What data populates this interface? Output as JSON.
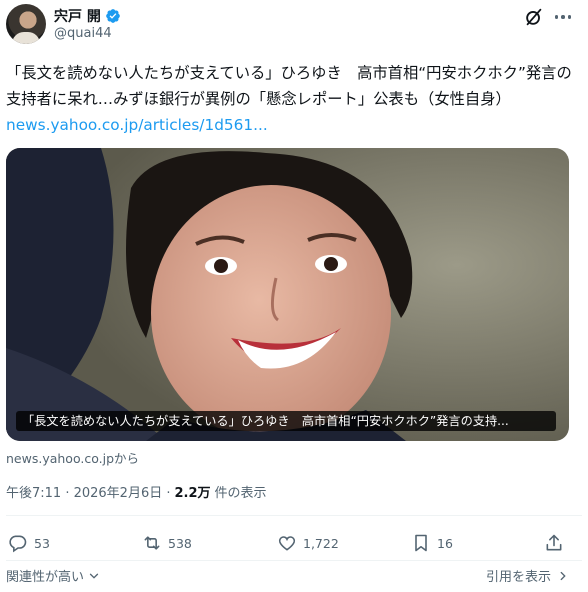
{
  "author": {
    "display_name": "宍戸 開",
    "handle": "@quai44"
  },
  "tweet": {
    "text": "「長文を読めない人たちが支えている」ひろゆき　高市首相“円安ホクホク”発言の支持者に呆れ…みずほ銀行が異例の「懸念レポート」公表も（女性自身）",
    "link": "news.yahoo.co.jp/articles/1d561..."
  },
  "card": {
    "caption": "「長文を読めない人たちが支えている」ひろゆき　高市首相“円安ホクホク”発言の支持...",
    "source": "news.yahoo.co.jpから"
  },
  "meta": {
    "timestamp": "午後7:11 · 2026年2月6日 ·",
    "views_count": "2.2万",
    "views_label": "件の表示"
  },
  "actions": {
    "replies": "53",
    "retweets": "538",
    "likes": "1,722",
    "bookmarks": "16"
  },
  "footer": {
    "sort_label": "関連性が高い",
    "quotes_label": "引用を表示"
  },
  "colors": {
    "accent": "#1d9bf0",
    "text_primary": "#0f1419",
    "text_secondary": "#536471"
  },
  "icons": [
    "verified-badge-icon",
    "grok-icon",
    "more-icon",
    "reply-icon",
    "retweet-icon",
    "like-icon",
    "bookmark-icon",
    "share-icon",
    "chevron-down-icon",
    "chevron-right-icon"
  ]
}
